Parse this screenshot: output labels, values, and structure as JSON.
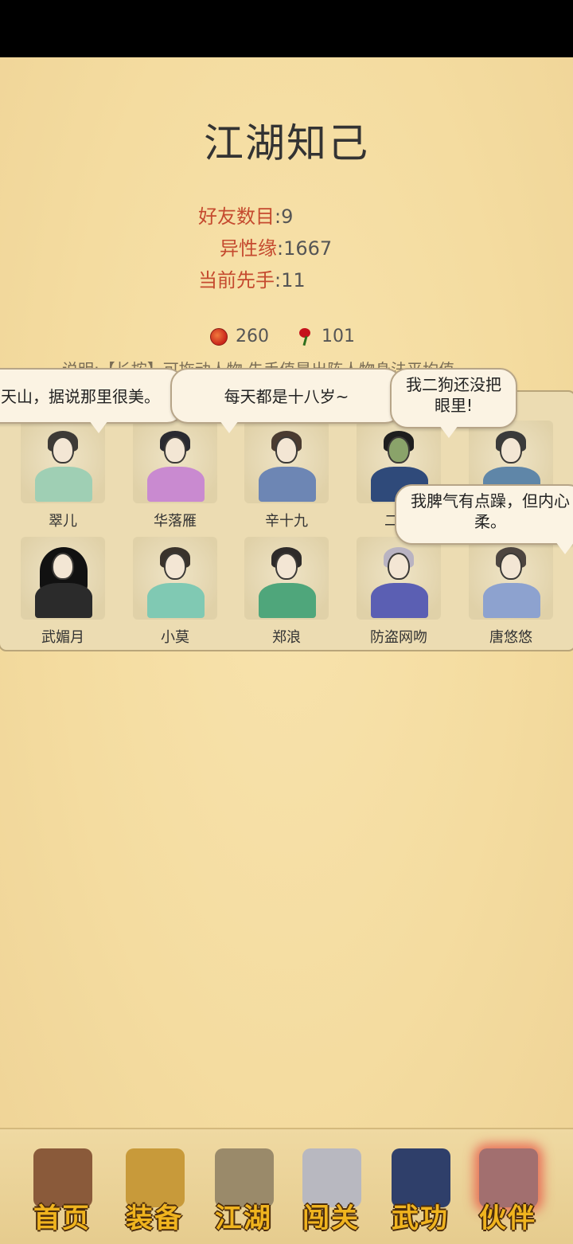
{
  "page": {
    "title": "江湖知己"
  },
  "stats": {
    "friends_label": "好友数目",
    "friends_value": ":9",
    "affinity_label": "异性缘",
    "affinity_value": ":1667",
    "initiative_label": "当前先手",
    "initiative_value": ":11"
  },
  "currency": {
    "pot": "260",
    "rose": "101"
  },
  "note": "说明:【长按】可拖动人物,先手值是出阵人物身法平均值",
  "friends": [
    {
      "name": "翠儿",
      "robe": "#9fcfb4",
      "hair": "#3d3a36"
    },
    {
      "name": "华落雁",
      "robe": "#c98ad0",
      "hair": "#2a2a30"
    },
    {
      "name": "辛十九",
      "robe": "#6d86b4",
      "hair": "#4a3b30"
    },
    {
      "name": "二狗",
      "robe": "#2f4a7a",
      "hair": "#1e1e1e"
    },
    {
      "name": "",
      "robe": "#5f86a8",
      "hair": "#3a3a3a"
    },
    {
      "name": "武媚月",
      "robe": "#2b2b2b",
      "hair": "#111111"
    },
    {
      "name": "小莫",
      "robe": "#80c9b3",
      "hair": "#3a332c"
    },
    {
      "name": "郑浪",
      "robe": "#4fa67b",
      "hair": "#2e2b2a"
    },
    {
      "name": "防盗网吻",
      "robe": "#5b5fb3",
      "hair": "#b9b3c2"
    },
    {
      "name": "唐悠悠",
      "robe": "#8da2cf",
      "hair": "#4d4540"
    }
  ],
  "bubbles": {
    "b1": "天山，据说那里很美。",
    "b2": "每天都是十八岁~",
    "b3_line1": "我二狗还没把",
    "b3_line2": "眼里!",
    "b4_line1": "我脾气有点躁，但内心",
    "b4_line2": "柔。"
  },
  "nav": [
    {
      "label": "首页",
      "icon": "house-icon",
      "color": "#8a5a3a"
    },
    {
      "label": "装备",
      "icon": "armor-icon",
      "color": "#c89a3a"
    },
    {
      "label": "江湖",
      "icon": "scroll-map-icon",
      "color": "#9a8a6a"
    },
    {
      "label": "闯关",
      "icon": "crossed-swords-icon",
      "color": "#b8b8c0"
    },
    {
      "label": "武功",
      "icon": "book-icon",
      "color": "#2f3f6a"
    },
    {
      "label": "伙伴",
      "icon": "companions-icon",
      "color": "#a26f6f"
    }
  ]
}
